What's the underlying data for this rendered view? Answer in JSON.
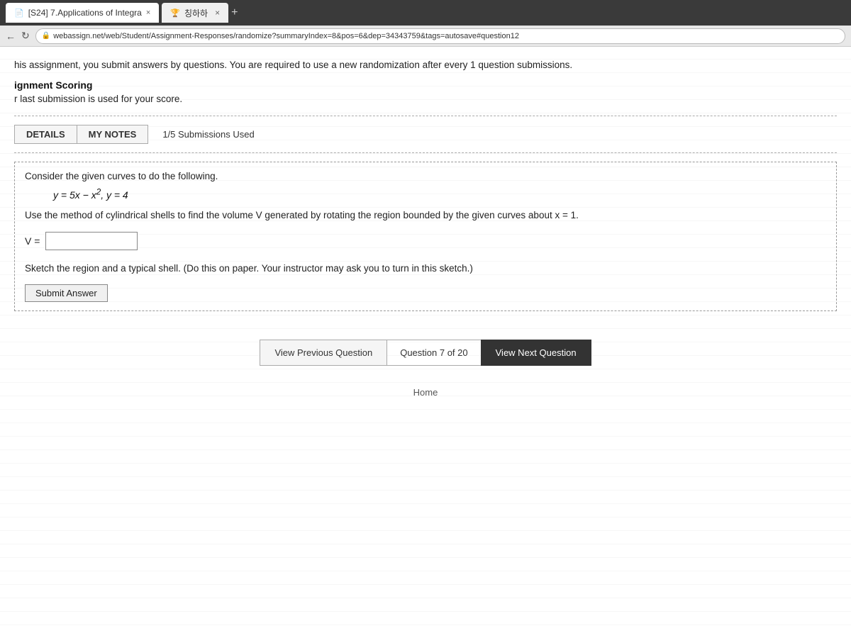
{
  "browser": {
    "tabs": [
      {
        "id": "tab1",
        "label": "[S24] 7.Applications of Integra",
        "active": true,
        "icon": "📄"
      },
      {
        "id": "tab2",
        "label": "칭하하",
        "active": false,
        "icon": "🏆"
      }
    ],
    "tab_close_label": "×",
    "tab_plus_label": "+",
    "tab_x_label": "×",
    "url": "webassign.net/web/Student/Assignment-Responses/randomize?summaryIndex=8&pos=6&dep=34343759&tags=autosave#question12",
    "lock_icon": "🔒",
    "nav_back": "←",
    "nav_refresh": "↻"
  },
  "page": {
    "intro_text": "his assignment, you submit answers by questions. You are required to use a new randomization after every 1 question submissions.",
    "scoring_header": "ignment Scoring",
    "scoring_text": "r last submission is used for your score.",
    "tabs": {
      "details_label": "DETAILS",
      "notes_label": "MY NOTES",
      "submissions_used": "1/5 Submissions Used"
    },
    "question": {
      "intro": "Consider the given curves to do the following.",
      "equation": "y = 5x − x², y = 4",
      "body": "Use the method of cylindrical shells to find the volume V generated by rotating the region bounded by the given curves about x = 1.",
      "answer_label": "V =",
      "answer_placeholder": "",
      "sketch_text": "Sketch the region and a typical shell. (Do this on paper. Your instructor may ask you to turn in this sketch.)",
      "submit_label": "Submit Answer"
    },
    "navigation": {
      "prev_label": "View Previous Question",
      "counter": "Question 7 of 20",
      "next_label": "View Next Question"
    },
    "footer": {
      "home_label": "Home"
    }
  }
}
